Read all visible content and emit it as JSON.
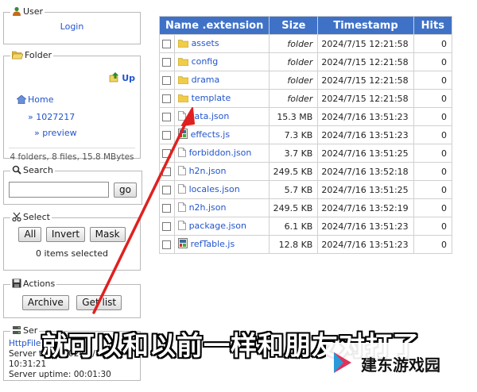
{
  "sidebar": {
    "user": {
      "legend": "User",
      "login": "Login"
    },
    "folder": {
      "legend": "Folder",
      "up": "Up",
      "tree": [
        "Home",
        "» 1027217",
        "» preview"
      ],
      "info": "4 folders, 8 files, 15.8 MBytes"
    },
    "search": {
      "legend": "Search",
      "input_value": "",
      "go": "go"
    },
    "select": {
      "legend": "Select",
      "all": "All",
      "invert": "Invert",
      "mask": "Mask",
      "count": "0 items selected"
    },
    "actions": {
      "legend": "Actions",
      "archive": "Archive",
      "getlist": "Get list"
    },
    "server": {
      "legend": "Ser",
      "link": "HttpFile",
      "time": "Server time: 2024/7/19 10:31:21",
      "uptime": "Server uptime: 00:01:30"
    }
  },
  "table": {
    "headers": {
      "name": "Name .extension",
      "size": "Size",
      "timestamp": "Timestamp",
      "hits": "Hits"
    },
    "rows": [
      {
        "name": "assets",
        "icon": "folder-icon",
        "size": "folder",
        "ts": "2024/7/15 12:21:58",
        "hits": "0"
      },
      {
        "name": "config",
        "icon": "folder-icon",
        "size": "folder",
        "ts": "2024/7/15 12:21:58",
        "hits": "0"
      },
      {
        "name": "drama",
        "icon": "folder-icon",
        "size": "folder",
        "ts": "2024/7/15 12:21:58",
        "hits": "0"
      },
      {
        "name": "template",
        "icon": "folder-icon",
        "size": "folder",
        "ts": "2024/7/15 12:21:58",
        "hits": "0"
      },
      {
        "name": "data.json",
        "icon": "file-icon",
        "size": "15.3 MB",
        "ts": "2024/7/16 13:51:23",
        "hits": "0"
      },
      {
        "name": "effects.js",
        "icon": "script-icon",
        "size": "7.3 KB",
        "ts": "2024/7/16 13:51:23",
        "hits": "0"
      },
      {
        "name": "forbiddon.json",
        "icon": "file-icon",
        "size": "3.7 KB",
        "ts": "2024/7/16 13:51:25",
        "hits": "0"
      },
      {
        "name": "h2n.json",
        "icon": "file-icon",
        "size": "249.5 KB",
        "ts": "2024/7/16 13:52:18",
        "hits": "0"
      },
      {
        "name": "locales.json",
        "icon": "file-icon",
        "size": "5.7 KB",
        "ts": "2024/7/16 13:51:25",
        "hits": "0"
      },
      {
        "name": "n2h.json",
        "icon": "file-icon",
        "size": "249.5 KB",
        "ts": "2024/7/16 13:52:19",
        "hits": "0"
      },
      {
        "name": "package.json",
        "icon": "file-icon",
        "size": "6.1 KB",
        "ts": "2024/7/16 13:51:23",
        "hits": "0"
      },
      {
        "name": "refTable.js",
        "icon": "script-icon",
        "size": "12.8 KB",
        "ts": "2024/7/16 13:51:23",
        "hits": "0"
      }
    ]
  },
  "overlay": {
    "caption": "就可以和以前一样和朋友对打了",
    "watermark": "建东游戏园"
  },
  "colors": {
    "header_bg": "#3f72c7",
    "link": "#2255cc",
    "arrow": "#e02020"
  }
}
